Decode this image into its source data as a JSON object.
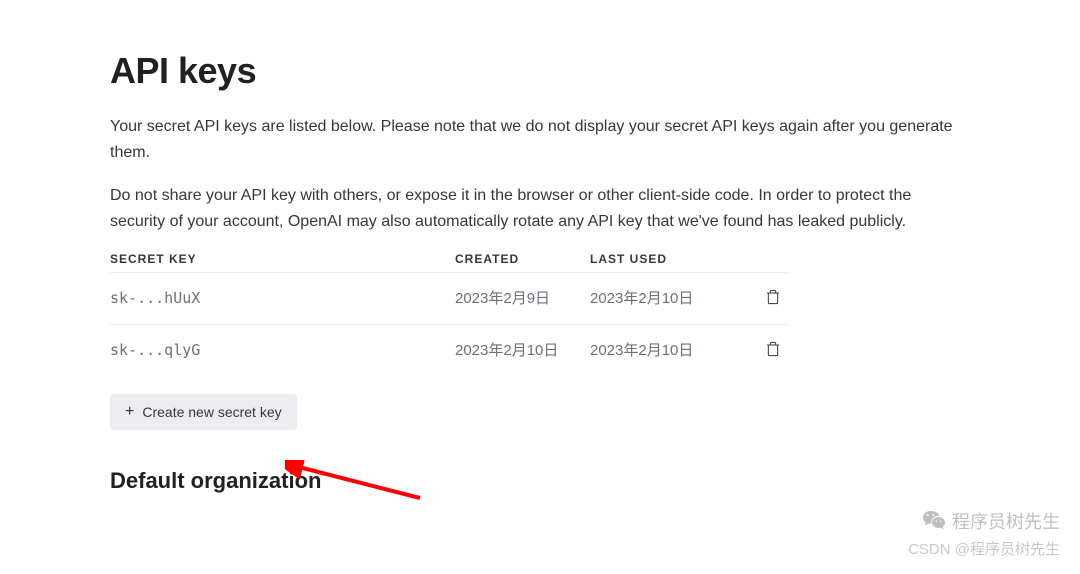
{
  "header": {
    "title": "API keys"
  },
  "paragraphs": {
    "p1": "Your secret API keys are listed below. Please note that we do not display your secret API keys again after you generate them.",
    "p2": "Do not share your API key with others, or expose it in the browser or other client-side code. In order to protect the security of your account, OpenAI may also automatically rotate any API key that we've found has leaked publicly."
  },
  "table": {
    "columns": {
      "secret_key": "SECRET KEY",
      "created": "CREATED",
      "last_used": "LAST USED"
    },
    "rows": [
      {
        "key": "sk-...hUuX",
        "created": "2023年2月9日",
        "last_used": "2023年2月10日"
      },
      {
        "key": "sk-...qlyG",
        "created": "2023年2月10日",
        "last_used": "2023年2月10日"
      }
    ]
  },
  "buttons": {
    "create_label": "Create new secret key"
  },
  "sections": {
    "default_org": "Default organization"
  },
  "watermarks": {
    "wechat": "程序员树先生",
    "csdn": "CSDN @程序员树先生"
  }
}
